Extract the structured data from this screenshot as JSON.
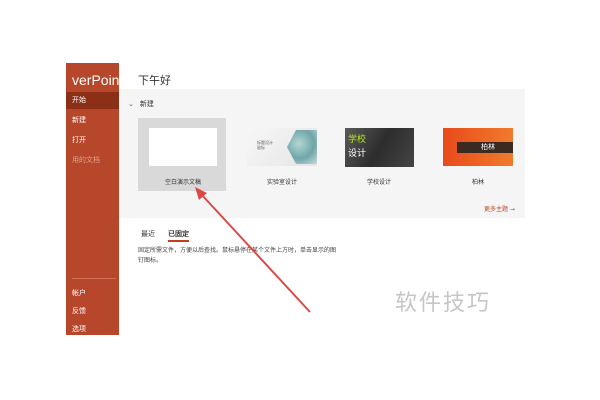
{
  "app": {
    "title": "verPoint"
  },
  "sidebar": {
    "items": [
      {
        "label": "开始"
      },
      {
        "label": "新建"
      },
      {
        "label": "打开"
      },
      {
        "label": "用的文档"
      }
    ],
    "bottom_items": [
      {
        "label": "帐户"
      },
      {
        "label": "反馈"
      },
      {
        "label": "选项"
      }
    ]
  },
  "main": {
    "greeting": "下午好",
    "new_section": {
      "header": "新建"
    },
    "templates": [
      {
        "label": "空白演示文稿"
      },
      {
        "label": "实验室设计",
        "thumb_text": "标题设计\n副标"
      },
      {
        "label": "学校设计",
        "thumb_line1": "学校",
        "thumb_line2": "设计"
      },
      {
        "label": "柏林",
        "thumb_text": "柏林"
      }
    ],
    "more_themes": "更多主题 →",
    "tabs": [
      {
        "label": "最近"
      },
      {
        "label": "已固定"
      }
    ],
    "pinned_desc": "固定所需文件，方便以后查找。鼠标悬停在某个文件上方时，单击显示的图钉图标。"
  },
  "watermark": "软件技巧",
  "colors": {
    "accent": "#b7472a",
    "arrow": "#d94a47"
  }
}
